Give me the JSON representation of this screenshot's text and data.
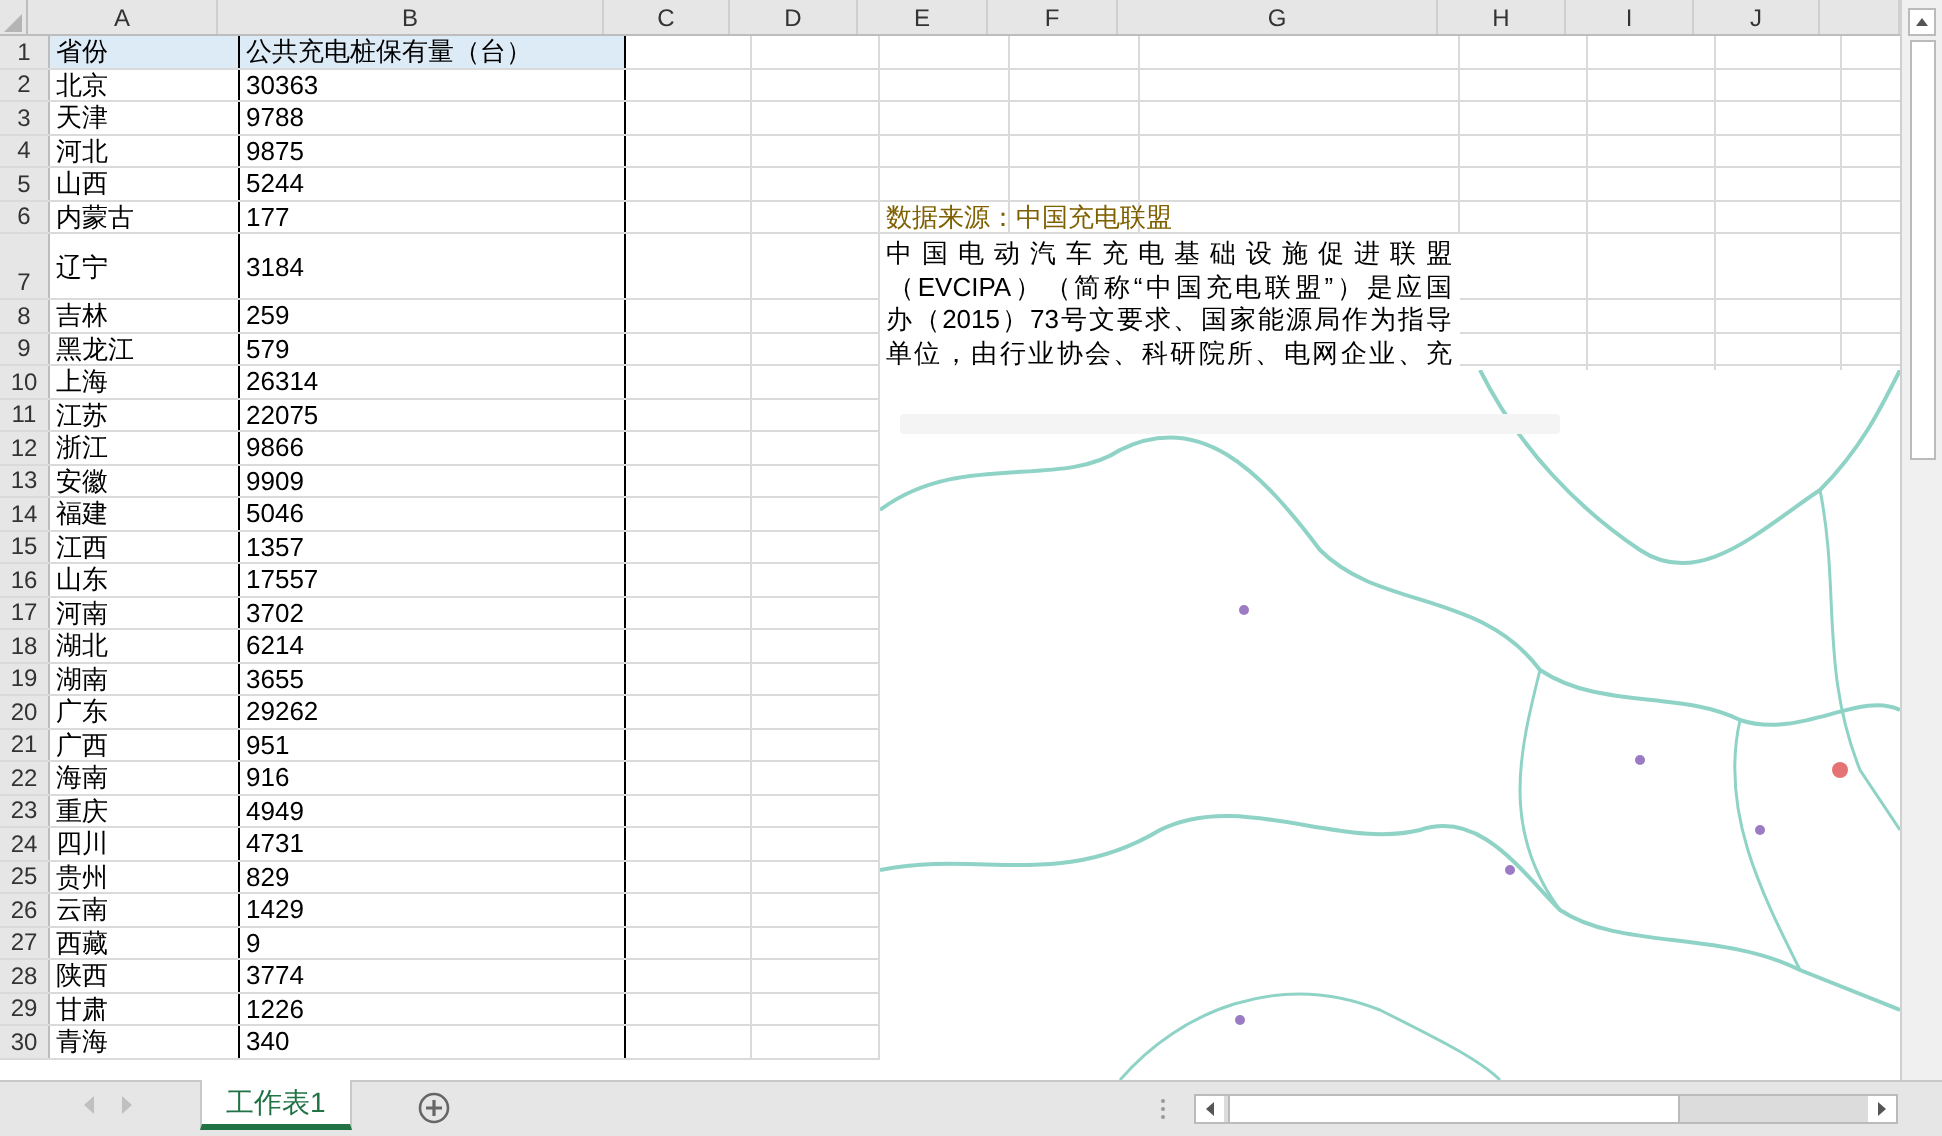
{
  "column_headers": [
    "A",
    "B",
    "C",
    "D",
    "E",
    "F",
    "G",
    "H",
    "I",
    "J"
  ],
  "rows": [
    {
      "header": "1",
      "cells": [
        "省份",
        "公共充电桩保有量（台）"
      ]
    },
    {
      "header": "2",
      "cells": [
        "北京",
        "30363"
      ]
    },
    {
      "header": "3",
      "cells": [
        "天津",
        "9788"
      ]
    },
    {
      "header": "4",
      "cells": [
        "河北",
        "9875"
      ]
    },
    {
      "header": "5",
      "cells": [
        "山西",
        "5244"
      ]
    },
    {
      "header": "6",
      "cells": [
        "内蒙古",
        "177"
      ]
    },
    {
      "header": "7",
      "cells": [
        "辽宁",
        "3184"
      ]
    },
    {
      "header": "8",
      "cells": [
        "吉林",
        "259"
      ]
    },
    {
      "header": "9",
      "cells": [
        "黑龙江",
        "579"
      ]
    },
    {
      "header": "10",
      "cells": [
        "上海",
        "26314"
      ]
    },
    {
      "header": "11",
      "cells": [
        "江苏",
        "22075"
      ]
    },
    {
      "header": "12",
      "cells": [
        "浙江",
        "9866"
      ]
    },
    {
      "header": "13",
      "cells": [
        "安徽",
        "9909"
      ]
    },
    {
      "header": "14",
      "cells": [
        "福建",
        "5046"
      ]
    },
    {
      "header": "15",
      "cells": [
        "江西",
        "1357"
      ]
    },
    {
      "header": "16",
      "cells": [
        "山东",
        "17557"
      ]
    },
    {
      "header": "17",
      "cells": [
        "河南",
        "3702"
      ]
    },
    {
      "header": "18",
      "cells": [
        "湖北",
        "6214"
      ]
    },
    {
      "header": "19",
      "cells": [
        "湖南",
        "3655"
      ]
    },
    {
      "header": "20",
      "cells": [
        "广东",
        "29262"
      ]
    },
    {
      "header": "21",
      "cells": [
        "广西",
        "951"
      ]
    },
    {
      "header": "22",
      "cells": [
        "海南",
        "916"
      ]
    },
    {
      "header": "23",
      "cells": [
        "重庆",
        "4949"
      ]
    },
    {
      "header": "24",
      "cells": [
        "四川",
        "4731"
      ]
    },
    {
      "header": "25",
      "cells": [
        "贵州",
        "829"
      ]
    },
    {
      "header": "26",
      "cells": [
        "云南",
        "1429"
      ]
    },
    {
      "header": "27",
      "cells": [
        "西藏",
        "9"
      ]
    },
    {
      "header": "28",
      "cells": [
        "陕西",
        "3774"
      ]
    },
    {
      "header": "29",
      "cells": [
        "甘肃",
        "1226"
      ]
    },
    {
      "header": "30",
      "cells": [
        "青海",
        "340"
      ]
    }
  ],
  "source_note": "数据来源：中国充电联盟",
  "text_box": {
    "lines": [
      "中国电动汽车充电基础设施促进联盟",
      "（EVCIPA）（简称“中国充电联盟”）是应国",
      "办（2015）73号文要求、国家能源局作为指导",
      "单位，由行业协会、科研院所、电网企业、充"
    ]
  },
  "sheet_tabs": [
    {
      "label": "工作表1",
      "selected": true
    }
  ]
}
